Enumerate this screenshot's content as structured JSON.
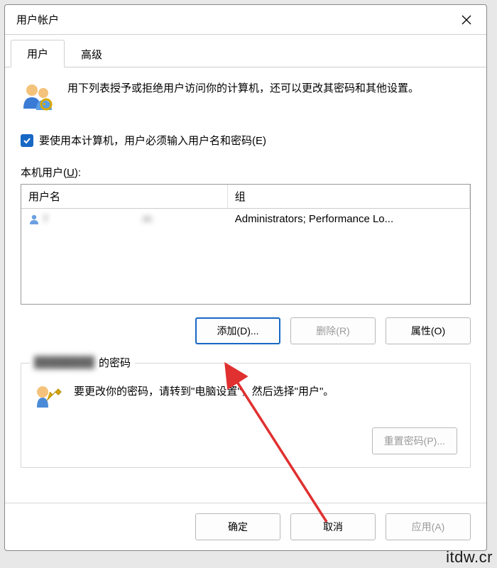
{
  "window": {
    "title": "用户帐户"
  },
  "tabs": {
    "users": "用户",
    "advanced": "高级"
  },
  "intro": "用下列表授予或拒绝用户访问你的计算机，还可以更改其密码和其他设置。",
  "checkbox": {
    "label": "要使用本计算机，用户必须输入用户名和密码(E)",
    "checked": true
  },
  "list": {
    "label_pre": "本机用户(",
    "label_u": "U",
    "label_post": "):",
    "cols": {
      "user": "用户名",
      "group": "组"
    },
    "rows": [
      {
        "user": "f         m",
        "group": "Administrators; Performance Lo..."
      }
    ]
  },
  "buttons": {
    "add": "添加(D)...",
    "remove": "删除(R)",
    "props": "属性(O)"
  },
  "pwd": {
    "legend_suffix": " 的密码",
    "legend_blur": "████████",
    "text": "要更改你的密码，请转到\"电脑设置\"，然后选择\"用户\"。",
    "reset": "重置密码(P)..."
  },
  "footer": {
    "ok": "确定",
    "cancel": "取消",
    "apply": "应用(A)"
  },
  "watermark": "itdw.cr"
}
